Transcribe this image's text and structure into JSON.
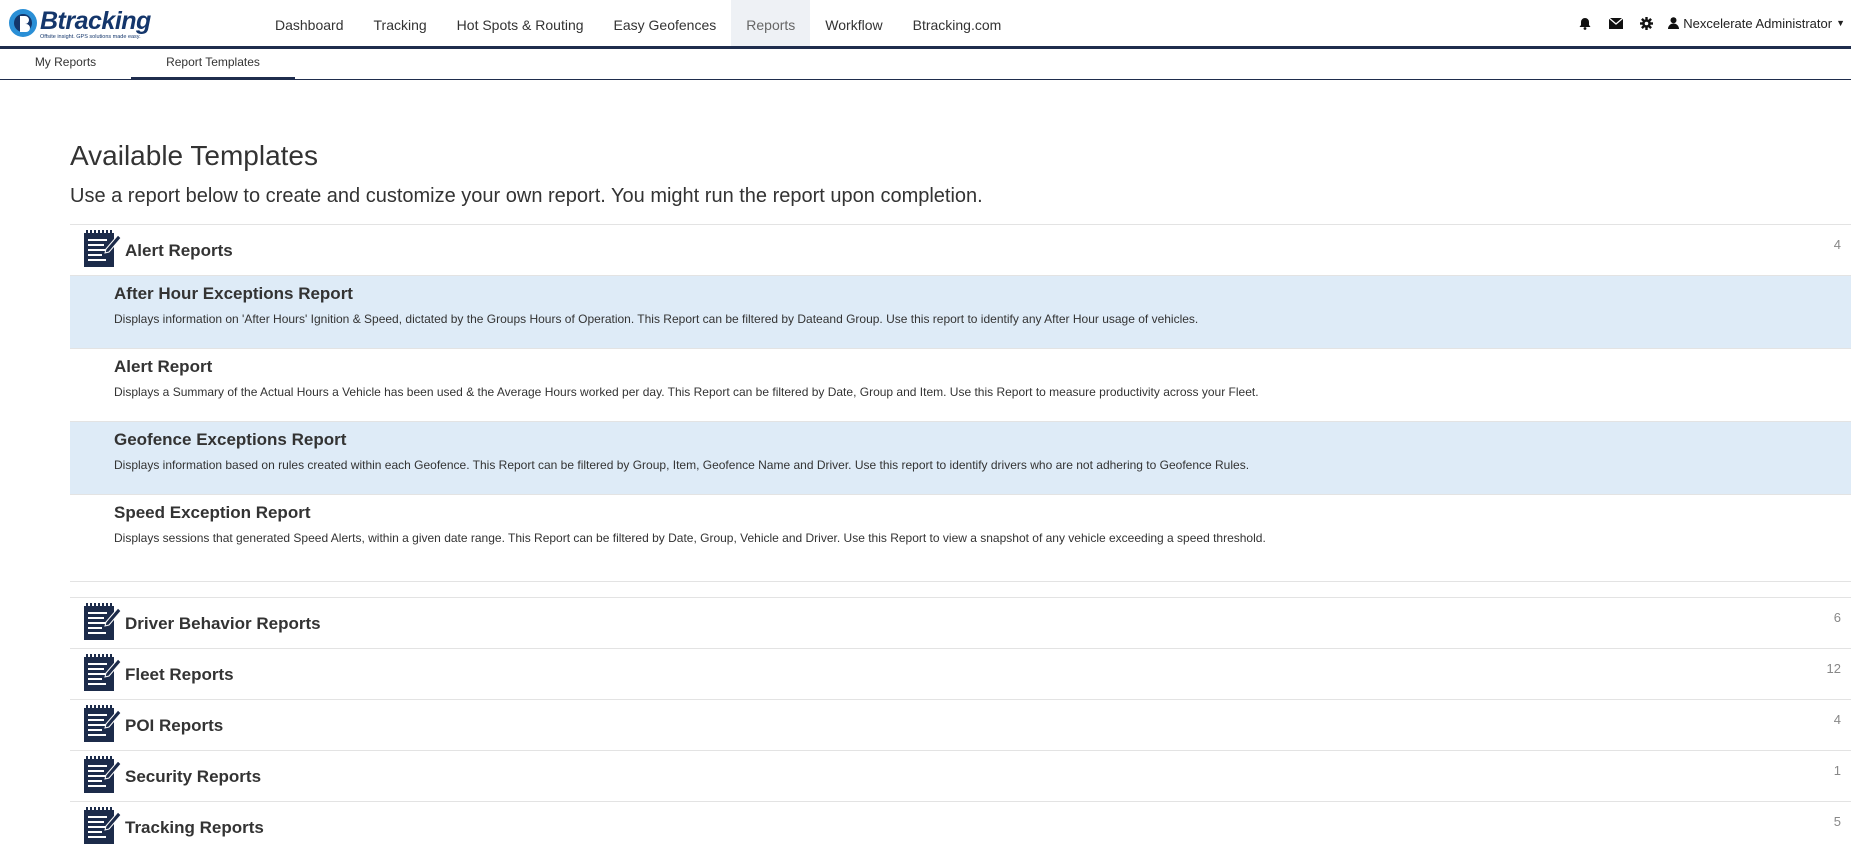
{
  "logo": {
    "name": "Btracking",
    "tagline": "Offsite insight. GPS solutions made easy."
  },
  "nav": {
    "items": [
      {
        "label": "Dashboard"
      },
      {
        "label": "Tracking"
      },
      {
        "label": "Hot Spots & Routing"
      },
      {
        "label": "Easy Geofences"
      },
      {
        "label": "Reports",
        "active": true
      },
      {
        "label": "Workflow"
      },
      {
        "label": "Btracking.com"
      }
    ]
  },
  "user": {
    "name": "Nexcelerate Administrator"
  },
  "subnav": {
    "my_reports": "My Reports",
    "report_templates": "Report Templates"
  },
  "page": {
    "title": "Available Templates",
    "subtitle": "Use a report below to create and customize your own report. You might run the report upon completion."
  },
  "groups": [
    {
      "title": "Alert Reports",
      "count": "4"
    },
    {
      "title": "Driver Behavior Reports",
      "count": "6"
    },
    {
      "title": "Fleet Reports",
      "count": "12"
    },
    {
      "title": "POI Reports",
      "count": "4"
    },
    {
      "title": "Security Reports",
      "count": "1"
    },
    {
      "title": "Tracking Reports",
      "count": "5"
    }
  ],
  "alert_reports": [
    {
      "title": "After Hour Exceptions Report",
      "desc": "Displays information on 'After Hours' Ignition & Speed, dictated by the Groups Hours of Operation. This Report can be filtered by Dateand Group. Use this report to identify any After Hour usage of vehicles."
    },
    {
      "title": "Alert Report",
      "desc": "Displays a Summary of the Actual Hours a Vehicle has been used & the Average Hours worked per day. This Report can be filtered by Date, Group and Item. Use this Report to measure productivity across your Fleet."
    },
    {
      "title": "Geofence Exceptions Report",
      "desc": "Displays information based on rules created within each Geofence. This Report can be filtered by Group, Item, Geofence Name and Driver. Use this report to identify drivers who are not adhering to Geofence Rules."
    },
    {
      "title": "Speed Exception Report",
      "desc": "Displays sessions that generated Speed Alerts, within a given date range. This Report can be filtered by Date, Group, Vehicle and Driver. Use this Report to view a snapshot of any vehicle exceeding a speed threshold."
    }
  ],
  "colors": {
    "brand": "#14366b",
    "nav_border": "#1f2d4d",
    "highlight": "#deebf7"
  }
}
